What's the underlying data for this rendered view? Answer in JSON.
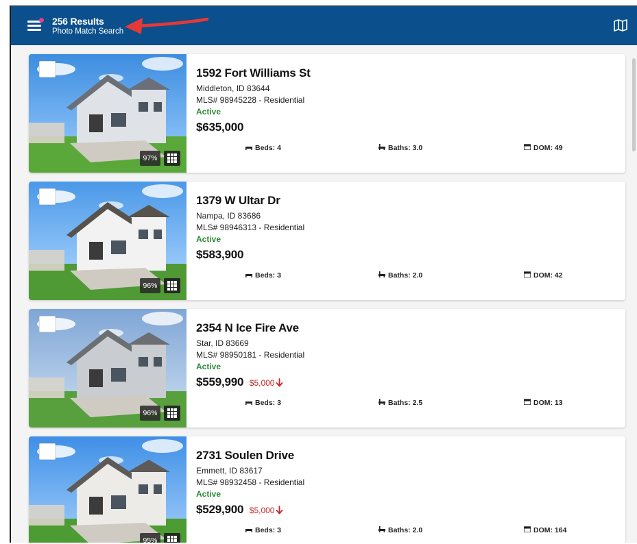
{
  "header": {
    "title": "256 Results",
    "subtitle": "Photo Match Search",
    "menu_icon": "hamburger-menu-icon",
    "map_icon": "map-icon",
    "brand_color": "#0b4f8c",
    "notification_dot_color": "#e83e8c"
  },
  "annotation": {
    "arrow_color": "#e53935"
  },
  "colors": {
    "status_active": "#2e8b3a",
    "price_drop": "#c62828"
  },
  "listings": [
    {
      "address": "1592 Fort Williams St",
      "city": "Middleton, ID 83644",
      "mls": "MLS# 98945228 - Residential",
      "status": "Active",
      "price": "$635,000",
      "price_drop": "",
      "beds": "Beds: 4",
      "baths": "Baths: 3.0",
      "dom": "DOM: 49",
      "match": "97%"
    },
    {
      "address": "1379 W Ultar Dr",
      "city": "Nampa, ID 83686",
      "mls": "MLS# 98946313 - Residential",
      "status": "Active",
      "price": "$583,900",
      "price_drop": "",
      "beds": "Beds: 3",
      "baths": "Baths: 2.0",
      "dom": "DOM: 42",
      "match": "96%"
    },
    {
      "address": "2354 N Ice Fire Ave",
      "city": "Star, ID 83669",
      "mls": "MLS# 98950181 - Residential",
      "status": "Active",
      "price": "$559,990",
      "price_drop": "$5,000",
      "beds": "Beds: 3",
      "baths": "Baths: 2.5",
      "dom": "DOM: 13",
      "match": "96%"
    },
    {
      "address": "2731 Soulen Drive",
      "city": "Emmett, ID 83617",
      "mls": "MLS# 98932458 - Residential",
      "status": "Active",
      "price": "$529,900",
      "price_drop": "$5,000",
      "beds": "Beds: 3",
      "baths": "Baths: 2.0",
      "dom": "DOM: 164",
      "match": "95%"
    }
  ]
}
